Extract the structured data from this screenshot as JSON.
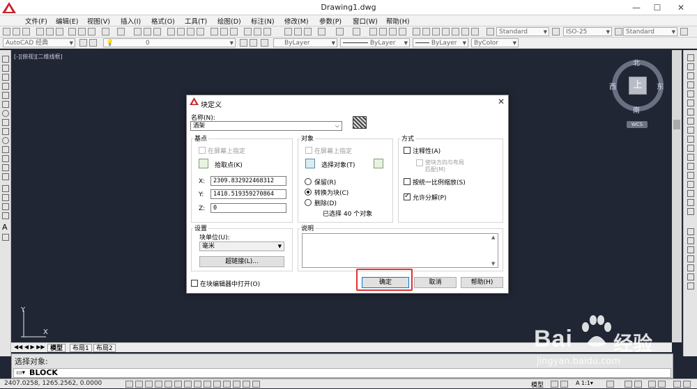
{
  "window": {
    "title": "Drawing1.dwg",
    "min": "—",
    "max": "☐",
    "close": "✕"
  },
  "menu": [
    "文件(F)",
    "编辑(E)",
    "视图(V)",
    "插入(I)",
    "格式(O)",
    "工具(T)",
    "绘图(D)",
    "标注(N)",
    "修改(M)",
    "参数(P)",
    "窗口(W)",
    "帮助(H)"
  ],
  "toolbar1": {
    "text_style": "Standard",
    "dim_style": "ISO-25",
    "table_style": "Standard"
  },
  "toolbar2": {
    "workspace": "AutoCAD 经典",
    "layer": "0",
    "color": "ByLayer",
    "linetype": "ByLayer",
    "lineweight": "ByLayer",
    "plotstyle": "ByColor"
  },
  "viewport": {
    "label": "[-][俯视][二维线框]"
  },
  "viewcube": {
    "north": "北",
    "south": "南",
    "west": "西",
    "east": "东",
    "face": "上",
    "wcs": "WCS"
  },
  "ucs": {
    "x": "X",
    "y": "Y"
  },
  "layout_tabs": [
    "模型",
    "布局1",
    "布局2"
  ],
  "command": {
    "history": "选择对象:",
    "current": "BLOCK"
  },
  "status": {
    "coords": "2407.0258, 1265.2562, 0.0000",
    "model": "模型",
    "scale": "1:1"
  },
  "dialog": {
    "title": "块定义",
    "name_label": "名称(N):",
    "name_value": "酒架",
    "base_point": {
      "title": "基点",
      "specify_on_screen": "在屏幕上指定",
      "pick_point": "拾取点(K)",
      "x_label": "X:",
      "x_value": "2309.832922468312",
      "y_label": "Y:",
      "y_value": "1418.519359270864",
      "z_label": "Z:",
      "z_value": "0"
    },
    "objects": {
      "title": "对象",
      "specify_on_screen": "在屏幕上指定",
      "select_objects": "选择对象(T)",
      "retain": "保留(R)",
      "convert": "转换为块(C)",
      "delete": "删除(D)",
      "selected_count": "已选择 40 个对象"
    },
    "behavior": {
      "title": "方式",
      "annotative": "注释性(A)",
      "match_orientation_1": "使块方向与布局",
      "match_orientation_2": "匹配(M)",
      "scale_uniformly": "按统一比例缩放(S)",
      "allow_exploding": "允许分解(P)"
    },
    "settings": {
      "title": "设置",
      "block_unit_label": "块单位(U):",
      "block_unit_value": "毫米",
      "hyperlink": "超链接(L)..."
    },
    "description": {
      "title": "说明",
      "value": ""
    },
    "open_in_editor": "在块编辑器中打开(O)",
    "ok": "确定",
    "cancel": "取消",
    "help": "帮助(H)"
  },
  "watermark": {
    "brand": "Bai",
    "brand2": "经验",
    "url": "jingyan.baidu.com"
  },
  "colors": {
    "canvas": "#202634",
    "accent": "#e03030"
  }
}
